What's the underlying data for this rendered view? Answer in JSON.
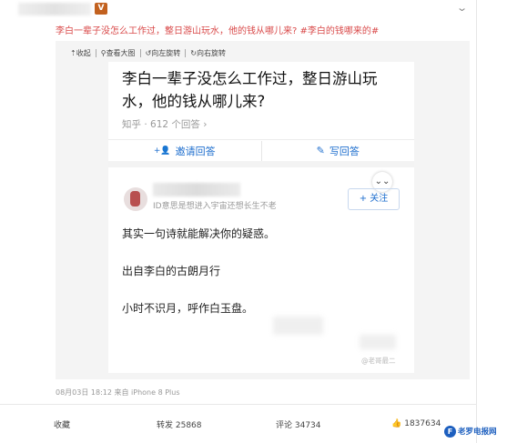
{
  "post": {
    "text_prefix": "李白一辈子没怎么工作过，整日游山玩水，他的",
    "text_link": "钱从哪儿来?",
    "hashtag": "#李白的钱哪来的#",
    "meta": "08月03日 18:12 来自 iPhone 8 Plus",
    "vip_badge": "V"
  },
  "image_toolbar": {
    "items": [
      {
        "icon": "arrow-up",
        "glyph": "⇡",
        "label": "收起"
      },
      {
        "icon": "search",
        "glyph": "⚲",
        "label": "查看大图"
      },
      {
        "icon": "rotate-left",
        "glyph": "↺",
        "label": "向左旋转"
      },
      {
        "icon": "rotate-right",
        "glyph": "↻",
        "label": "向右旋转"
      }
    ]
  },
  "question": {
    "title": "李白一辈子没怎么工作过，整日游山玩水，他的钱从哪儿来?",
    "meta": "知乎 · 612 个回答 ›"
  },
  "actions": {
    "invite_label": "邀请回答",
    "invite_icon": "+👤",
    "write_label": "写回答",
    "write_icon": "✎"
  },
  "answer": {
    "bio": "ID意思是想进入宇宙还想长生不老",
    "follow_label": "+ 关注",
    "collapse_glyph": "⌄⌄",
    "lines": [
      "其实一句诗就能解决你的疑惑。",
      "出自李白的古朗月行",
      "小时不识月，呼作白玉盘。"
    ]
  },
  "watermark": "@老哥最二",
  "stats": {
    "favorite": "收藏",
    "repost": "转发 25868",
    "comment": "评论 34734",
    "like": "1837634",
    "like_icon": "👍"
  },
  "site_logo": {
    "mark": "F",
    "text": "老罗电报网"
  },
  "colors": {
    "accent_blue": "#1f6fce",
    "highlight_red": "#d94a4a",
    "badge_orange": "#c2611f"
  }
}
